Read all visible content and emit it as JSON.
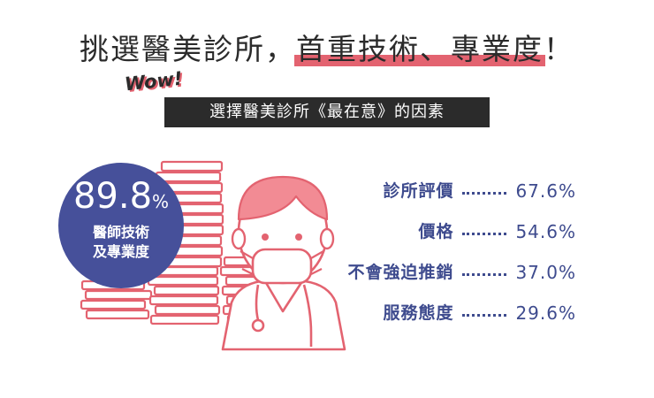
{
  "headline": {
    "before": "挑選醫美診所，",
    "highlight": "首重技術、專業度",
    "after": "！"
  },
  "wow": "Wow!",
  "subtitle": "選擇醫美診所《最在意》的因素",
  "colors": {
    "accent": "#e36370",
    "navy": "#46509a",
    "dark": "#2b2b2b",
    "value_text": "#3e4b8e"
  },
  "icons": [
    "book-stack-icon",
    "doctor-with-mask-icon"
  ],
  "chart_data": {
    "type": "bar",
    "title": "選擇醫美診所《最在意》的因素",
    "highlight": {
      "value": 89.8,
      "unit": "%",
      "label_line1": "醫師技術",
      "label_line2": "及專業度"
    },
    "categories": [
      "診所評價",
      "價格",
      "不會強迫推銷",
      "服務態度"
    ],
    "values": [
      67.6,
      54.6,
      37.0,
      29.6
    ],
    "value_labels": [
      "67.6%",
      "54.6%",
      "37.0%",
      "29.6%"
    ],
    "unit": "%"
  }
}
